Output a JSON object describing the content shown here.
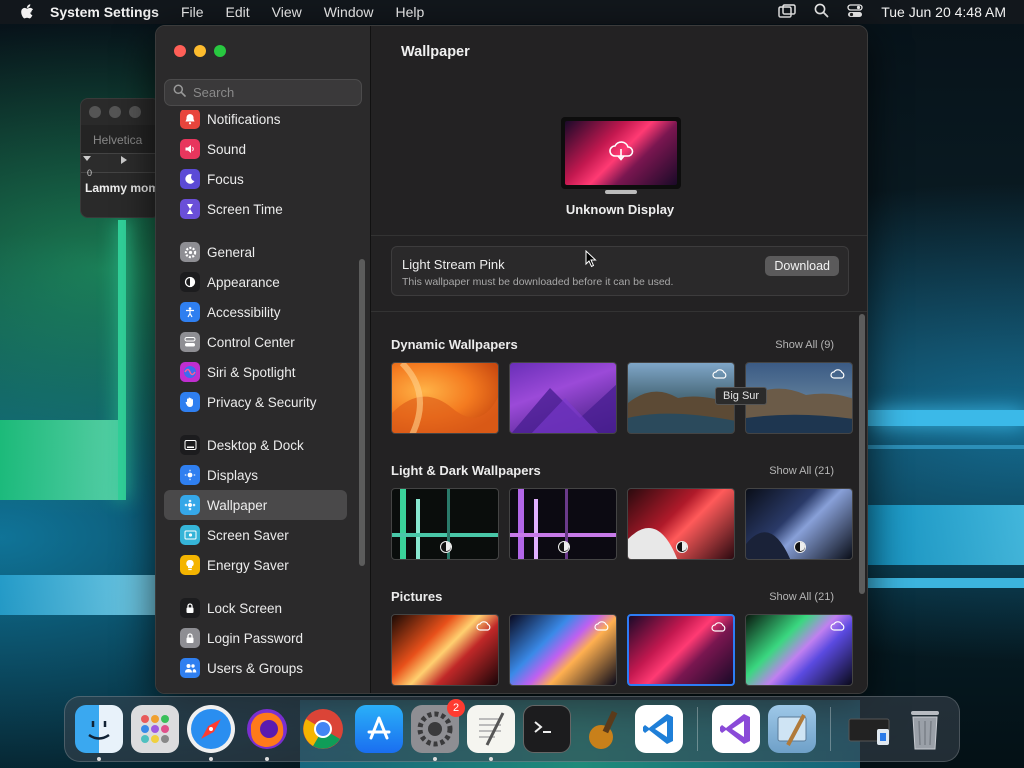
{
  "menubar": {
    "app_name": "System Settings",
    "items": [
      "File",
      "Edit",
      "View",
      "Window",
      "Help"
    ],
    "clock": "Tue Jun 20  4:48 AM"
  },
  "font_panel": {
    "font_name": "Helvetica",
    "ruler_zero": "0",
    "sample_text": "Lammy mom"
  },
  "sidebar": {
    "search_placeholder": "Search",
    "groups": [
      [
        {
          "label": "Notifications",
          "icon": "bell-icon",
          "color": "#e8453c"
        },
        {
          "label": "Sound",
          "icon": "speaker-icon",
          "color": "#e8365d"
        },
        {
          "label": "Focus",
          "icon": "moon-icon",
          "color": "#5b4ad6"
        },
        {
          "label": "Screen Time",
          "icon": "hourglass-icon",
          "color": "#6a4fd8"
        }
      ],
      [
        {
          "label": "General",
          "icon": "gear-icon",
          "color": "#8e8e93"
        },
        {
          "label": "Appearance",
          "icon": "appearance-icon",
          "color": "#1c1c1e"
        },
        {
          "label": "Accessibility",
          "icon": "accessibility-icon",
          "color": "#2f7ff0"
        },
        {
          "label": "Control Center",
          "icon": "control-center-icon",
          "color": "#8e8e93"
        },
        {
          "label": "Siri & Spotlight",
          "icon": "siri-icon",
          "color": "#c02ed0"
        },
        {
          "label": "Privacy & Security",
          "icon": "hand-icon",
          "color": "#2f7ff0"
        }
      ],
      [
        {
          "label": "Desktop & Dock",
          "icon": "dock-icon",
          "color": "#1c1c1e"
        },
        {
          "label": "Displays",
          "icon": "displays-icon",
          "color": "#2f7ff0"
        },
        {
          "label": "Wallpaper",
          "icon": "wallpaper-icon",
          "color": "#35a7e8",
          "active": true
        },
        {
          "label": "Screen Saver",
          "icon": "screen-saver-icon",
          "color": "#35b4d8"
        },
        {
          "label": "Energy Saver",
          "icon": "lightbulb-icon",
          "color": "#f4b400"
        }
      ],
      [
        {
          "label": "Lock Screen",
          "icon": "lock-icon",
          "color": "#1c1c1e"
        },
        {
          "label": "Login Password",
          "icon": "lock-icon",
          "color": "#8e8e93"
        },
        {
          "label": "Users & Groups",
          "icon": "users-icon",
          "color": "#2f7ff0"
        }
      ]
    ]
  },
  "main": {
    "title": "Wallpaper",
    "display_name": "Unknown Display",
    "download_box": {
      "title": "Light Stream Pink",
      "subtitle": "This wallpaper must be downloaded before it can be used.",
      "button": "Download"
    },
    "tooltip": "Big Sur",
    "sections": [
      {
        "title": "Dynamic Wallpapers",
        "show_all": "Show All (9)"
      },
      {
        "title": "Light & Dark Wallpapers",
        "show_all": "Show All (21)"
      },
      {
        "title": "Pictures",
        "show_all": "Show All (21)"
      }
    ]
  },
  "dock": {
    "apps": [
      "Finder",
      "Launchpad",
      "Safari",
      "Firefox",
      "Chrome",
      "App Store",
      "System Settings",
      "TextEdit",
      "Terminal",
      "Instruments",
      "Visual Studio Code",
      "Visual Studio",
      "Preview",
      "Screenshot",
      "Trash"
    ],
    "settings_badge": "2"
  },
  "colors": {
    "accent": "#2d7df6",
    "sidebar_bg": "#2b2a2b",
    "main_bg": "#232223"
  }
}
